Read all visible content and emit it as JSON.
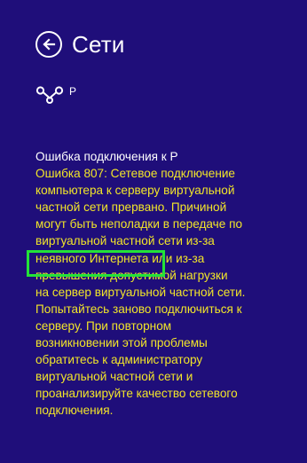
{
  "header": {
    "title": "Сети",
    "back_icon": "back-arrow-circle-icon"
  },
  "connection": {
    "icon": "vpn-connection-icon",
    "name": "P"
  },
  "error": {
    "title": "Ошибка подключения к P",
    "message": "Ошибка 807: Сетевое подключение\nкомпьютера к серверу виртуальной\nчастной сети прервано.  Причиной\nмогут быть неполадки в передаче по\nвиртуальной частной сети из-за\nнеявного Интернета или из-за\nпревышения допустимой нагрузки\nна сервер виртуальной частной сети.\nПопытайтесь заново подключиться к\nсерверу.  При повторном\nвозникновении этой проблемы\nобратитесь к администратору\nвиртуальной частной сети и\nпроанализируйте качество сетевого\nподключения."
  },
  "colors": {
    "background": "#1f0e7a",
    "error_text": "#f2e529",
    "highlight": "#23e238"
  }
}
